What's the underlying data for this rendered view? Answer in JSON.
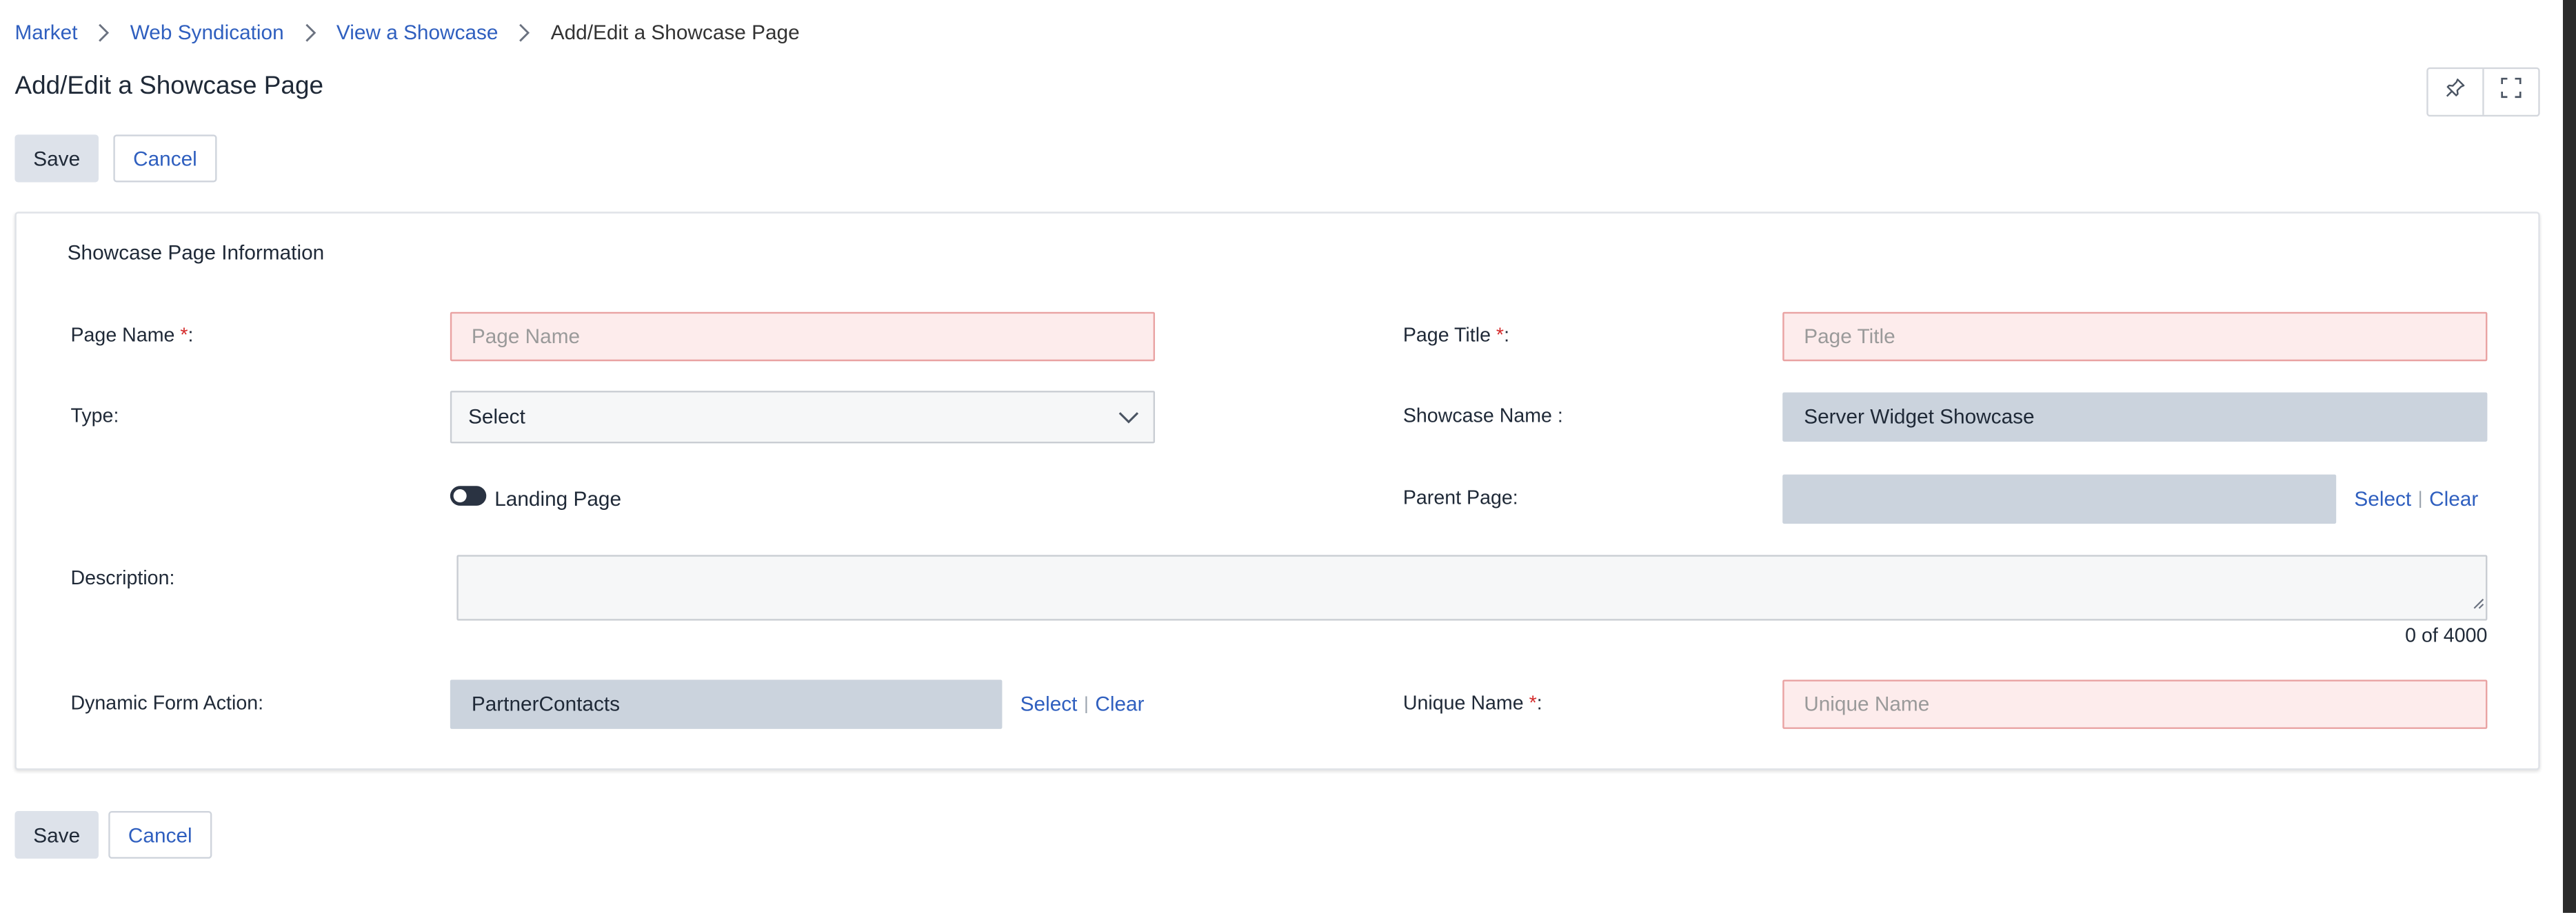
{
  "breadcrumb": {
    "items": [
      "Market",
      "Web Syndication",
      "View a Showcase"
    ],
    "current": "Add/Edit a Showcase Page"
  },
  "page_title": "Add/Edit a Showcase Page",
  "header_tools": {
    "pin_icon": "pin-icon",
    "expand_icon": "fullscreen-icon"
  },
  "actions": {
    "save_label": "Save",
    "cancel_label": "Cancel"
  },
  "section": {
    "title": "Showcase Page Information"
  },
  "fields": {
    "page_name": {
      "label": "Page Name ",
      "required_mark": "*",
      "suffix": ":",
      "placeholder": "Page Name",
      "value": ""
    },
    "page_title": {
      "label": "Page Title ",
      "required_mark": "*",
      "suffix": ":",
      "placeholder": "Page Title",
      "value": ""
    },
    "type": {
      "label": "Type:",
      "value": "Select"
    },
    "showcase_name": {
      "label": "Showcase Name :",
      "value": "Server Widget Showcase"
    },
    "landing_page": {
      "label": "Landing Page",
      "checked": false
    },
    "parent_page": {
      "label": "Parent Page:",
      "value": "",
      "select_label": "Select",
      "clear_label": "Clear"
    },
    "description": {
      "label": "Description:",
      "value": "",
      "counter": "0 of 4000"
    },
    "dynamic_form_action": {
      "label": "Dynamic Form Action:",
      "value": "PartnerContacts",
      "select_label": "Select",
      "clear_label": "Clear"
    },
    "unique_name": {
      "label": "Unique Name ",
      "required_mark": "*",
      "suffix": ":",
      "placeholder": "Unique Name",
      "value": ""
    }
  },
  "colors": {
    "link": "#2f5fbf",
    "required": "#d42b2b",
    "required_bg": "#fdecec",
    "readonly_bg": "#cbd3dd"
  }
}
